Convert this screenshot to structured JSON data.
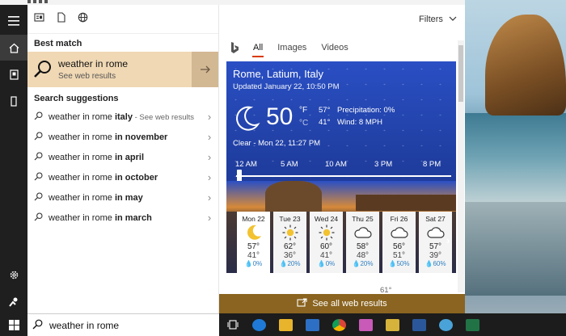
{
  "pane": {
    "best_match_heading": "Best match",
    "best_match_title": "weather in rome",
    "best_match_subtitle": "See web results",
    "suggestions_heading": "Search suggestions",
    "suggestions": [
      {
        "prefix": "weather in rome ",
        "bold": "italy",
        "note": " - See web results"
      },
      {
        "prefix": "weather in rome ",
        "bold": "in november",
        "note": ""
      },
      {
        "prefix": "weather in rome ",
        "bold": "in april",
        "note": ""
      },
      {
        "prefix": "weather in rome ",
        "bold": "in october",
        "note": ""
      },
      {
        "prefix": "weather in rome ",
        "bold": "in may",
        "note": ""
      },
      {
        "prefix": "weather in rome ",
        "bold": "in march",
        "note": ""
      }
    ]
  },
  "search": {
    "query": "weather in rome"
  },
  "results": {
    "filters_label": "Filters",
    "tabs": [
      "All",
      "Images",
      "Videos"
    ],
    "see_all_label": "See all web results"
  },
  "weather": {
    "location": "Rome, Latium, Italy",
    "updated": "Updated January 22, 10:50 PM",
    "temp": "50",
    "unit_f": "°F",
    "unit_c": "°C",
    "high": "57°",
    "low": "41°",
    "precipitation": "Precipitation: 0%",
    "wind": "Wind: 8 MPH",
    "condition": "Clear - Mon 22, 11:27 PM",
    "times": [
      "12 AM",
      "5 AM",
      "10 AM",
      "3 PM",
      "8 PM"
    ],
    "below_value": "61°",
    "days": [
      {
        "day": "Mon 22",
        "icon": "moon-icon",
        "hi": "57°",
        "lo": "41°",
        "precip": "💧0%"
      },
      {
        "day": "Tue 23",
        "icon": "sun-icon",
        "hi": "62°",
        "lo": "36°",
        "precip": "💧20%"
      },
      {
        "day": "Wed 24",
        "icon": "sun-icon",
        "hi": "60°",
        "lo": "41°",
        "precip": "💧0%"
      },
      {
        "day": "Thu 25",
        "icon": "cloud-icon",
        "hi": "58°",
        "lo": "48°",
        "precip": "💧20%"
      },
      {
        "day": "Fri 26",
        "icon": "cloud-icon",
        "hi": "56°",
        "lo": "51°",
        "precip": "💧50%"
      },
      {
        "day": "Sat 27",
        "icon": "cloud-icon",
        "hi": "57°",
        "lo": "39°",
        "precip": "💧60%"
      }
    ]
  },
  "colors": {
    "best_match_bg": "#f0d8b4",
    "see_all_bg": "#8a6420",
    "accent_tab": "#d83b01",
    "card_bg": "#2a4fc4"
  }
}
